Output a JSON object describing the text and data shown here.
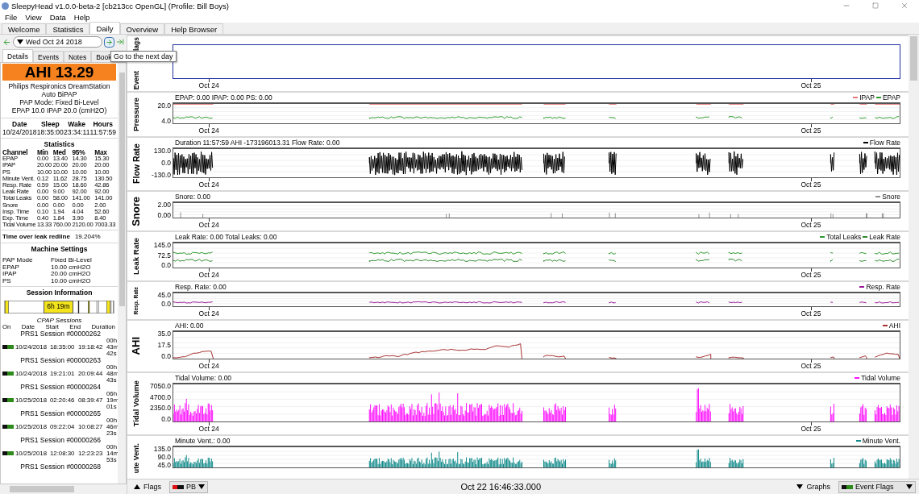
{
  "window": {
    "title": "SleepyHead v1.0.0-beta-2 [cb213cc OpenGL] (Profile:  Bill Boys)"
  },
  "menu": [
    "File",
    "View",
    "Data",
    "Help"
  ],
  "tabs": [
    {
      "label": "Welcome",
      "selected": false
    },
    {
      "label": "Statistics",
      "selected": false
    },
    {
      "label": "Daily",
      "selected": true
    },
    {
      "label": "Overview",
      "selected": false
    },
    {
      "label": "Help Browser",
      "selected": false
    }
  ],
  "date_nav": {
    "date": "Wed Oct 24 2018",
    "tooltip": "Go to the next day"
  },
  "detail_tabs": [
    {
      "label": "Details",
      "selected": true
    },
    {
      "label": "Events",
      "selected": false
    },
    {
      "label": "Notes",
      "selected": false
    },
    {
      "label": "Book",
      "selected": false
    }
  ],
  "details": {
    "ahi": "AHI 13.29",
    "machine": [
      "Philips Respironics DreamStation",
      "Auto BiPAP",
      "PAP Mode: Fixed Bi-Level",
      "EPAP 10.0 IPAP 20.0 (cmH2O)"
    ],
    "summary_columns": [
      "Date",
      "Sleep",
      "Wake",
      "Hours"
    ],
    "summary_values": [
      "10/24/2018",
      "18:35:00",
      "23:34:11",
      "11:57:59"
    ],
    "statistics_title": "Statistics",
    "statistics_columns": [
      "Channel",
      "Min",
      "Med",
      "95%",
      "Max"
    ],
    "statistics_rows": [
      [
        "EPAP",
        "0.00",
        "13.40",
        "14.30",
        "15.30"
      ],
      [
        "IPAP",
        "20.00",
        "20.00",
        "20.00",
        "20.00"
      ],
      [
        "PS",
        "10.00",
        "10.00",
        "10.00",
        "10.00"
      ],
      [
        "Minute Vent.",
        "0.12",
        "11.62",
        "28.75",
        "130.50"
      ],
      [
        "Resp. Rate",
        "0.59",
        "15.00",
        "18.60",
        "42.86"
      ],
      [
        "Leak Rate",
        "0.00",
        "9.00",
        "92.00",
        "92.00"
      ],
      [
        "Total Leaks",
        "0.00",
        "58.00",
        "141.00",
        "141.00"
      ],
      [
        "Snore",
        "0.00",
        "0.00",
        "0.00",
        "2.00"
      ],
      [
        "Insp. Time",
        "0.10",
        "1.94",
        "4.04",
        "52.60"
      ],
      [
        "Exp. Time",
        "0.40",
        "1.84",
        "3.90",
        "8.40"
      ],
      [
        "Tidal Volume",
        "13.33",
        "760.00",
        "2120.00",
        "7003.33"
      ]
    ],
    "redline_label": "Time over leak redline",
    "redline_value": "19.204%",
    "machine_settings_title": "Machine Settings",
    "machine_settings": [
      [
        "PAP Mode",
        "Fixed Bi-Level"
      ],
      [
        "EPAP",
        "10.00 cmH2O"
      ],
      [
        "IPAP",
        "20.00 cmH2O"
      ],
      [
        "PS",
        "10.00 cmH2O"
      ]
    ],
    "session_info_title": "Session Information",
    "session_bar_label": "6h 19m",
    "sessions_title": "CPAP Sessions",
    "session_columns": [
      "On",
      "Date",
      "Start",
      "End",
      "Duration"
    ],
    "sessions": [
      {
        "name": "PRS1 Session #00000262",
        "enabled": true,
        "date": "10/24/2018",
        "start": "18:35:00",
        "end": "19:18:42",
        "duration": [
          "00h",
          "43m",
          "42s"
        ]
      },
      {
        "name": "PRS1 Session #00000263",
        "enabled": true,
        "date": "10/24/2018",
        "start": "19:21:01",
        "end": "20:09:44",
        "duration": [
          "00h",
          "48m",
          "43s"
        ]
      },
      {
        "name": "PRS1 Session #00000264",
        "enabled": true,
        "date": "10/25/2018",
        "start": "02:20:46",
        "end": "08:39:47",
        "duration": [
          "06h",
          "19m",
          "01s"
        ]
      },
      {
        "name": "PRS1 Session #00000265",
        "enabled": true,
        "date": "10/25/2018",
        "start": "09:22:04",
        "end": "10:08:27",
        "duration": [
          "00h",
          "46m",
          "23s"
        ]
      },
      {
        "name": "PRS1 Session #00000266",
        "enabled": true,
        "date": "10/25/2018",
        "start": "12:08:30",
        "end": "12:23:23",
        "duration": [
          "00h",
          "14m",
          "53s"
        ]
      },
      {
        "name": "PRS1 Session #00000268"
      }
    ]
  },
  "graphs": [
    {
      "kind": "flags",
      "label_parts": [
        "Event",
        "lags"
      ],
      "xticks": [
        "Oct 24",
        "Oct 25"
      ]
    },
    {
      "kind": "pressure",
      "label": "Pressure",
      "header": "EPAP: 0.00 IPAP: 0.00 PS: 0.00",
      "legend": [
        {
          "name": "IPAP",
          "color": "#e87878"
        },
        {
          "name": "EPAP",
          "color": "#2e9a2e"
        }
      ],
      "yticks": [
        "20.0",
        "4.0"
      ],
      "xticks": [
        "Oct 24",
        "Oct 25"
      ]
    },
    {
      "kind": "wave",
      "label": "Flow Rate",
      "header": "Duration 11:57:59 AHI -173196013.31 Flow Rate: 0.00",
      "legend": [
        {
          "name": "Flow Rate",
          "color": "#000000"
        }
      ],
      "yticks": [
        "130.0",
        "0.0",
        "-130.0"
      ],
      "xticks": [
        "Oct 24",
        "Oct 25"
      ]
    },
    {
      "kind": "spikes",
      "label": "Snore",
      "header": "Snore: 0.00",
      "legend": [
        {
          "name": "Snore",
          "color": "#909090"
        }
      ],
      "yticks": [
        "2.00",
        "0.00"
      ],
      "xticks": [
        "Oct 24",
        "Oct 25"
      ]
    },
    {
      "kind": "dual",
      "label": "Leak Rate",
      "header": "Leak Rate: 0.00 Total Leaks: 0.00",
      "legend": [
        {
          "name": "Total Leaks",
          "color": "#2e9a2e"
        },
        {
          "name": "Leak Rate",
          "color": "#2e8a2e"
        }
      ],
      "yticks": [
        "145.0",
        "72.5",
        "0.0"
      ],
      "xticks": [
        "Oct 24",
        "Oct 25"
      ]
    },
    {
      "kind": "line",
      "label": "Resp. Rate",
      "header": "Resp. Rate: 0.00",
      "legend": [
        {
          "name": "Resp. Rate",
          "color": "#9a1a9a"
        }
      ],
      "yticks": [
        "45.0",
        "0.0"
      ],
      "xticks": [
        "Oct 24",
        "Oct 25"
      ]
    },
    {
      "kind": "ramp",
      "label": "AHI",
      "header": "AHI: 0.00",
      "legend": [
        {
          "name": "AHI",
          "color": "#a83232"
        }
      ],
      "yticks": [
        "35.0",
        "17.5",
        "0.0"
      ],
      "xticks": [
        "Oct 24",
        "Oct 25"
      ]
    },
    {
      "kind": "bars",
      "label": "Tidal Volume",
      "header": "Tidal Volume: 0.00",
      "legend": [
        {
          "name": "Tidal Volume",
          "color": "#ff10ff"
        }
      ],
      "yticks": [
        "7050.0",
        "4700.0",
        "2350.0",
        "0.0"
      ],
      "xticks": [
        "Oct 24",
        "Oct 25"
      ]
    },
    {
      "kind": "bars",
      "label": "ute Vent.",
      "header": "Minute Vent.: 0.00",
      "legend": [
        {
          "name": "Minute Vent.",
          "color": "#108a8a"
        }
      ],
      "yticks": [
        "135.0",
        "90.0",
        "45.0"
      ]
    }
  ],
  "bottom_bar": {
    "flags": "Flags",
    "flag_choice": "PB",
    "time": "Oct 22 16:46:33.000",
    "graphs": "Graphs",
    "graph_choice": "Event Flags"
  }
}
